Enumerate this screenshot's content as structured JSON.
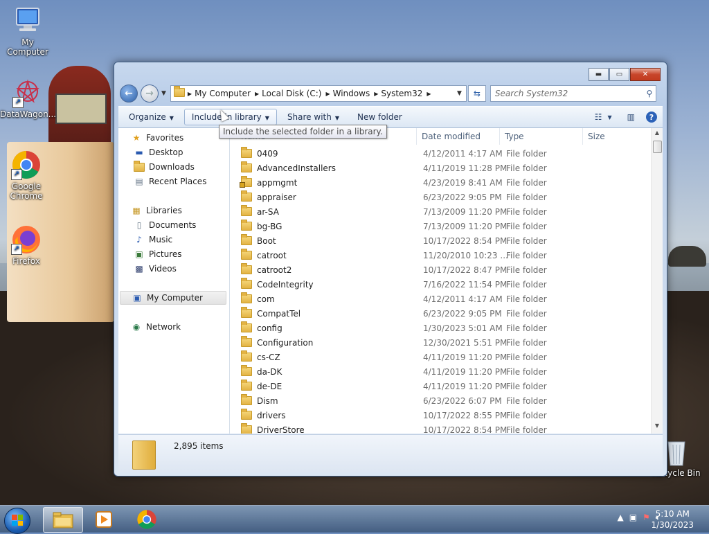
{
  "desktop": {
    "icons": [
      {
        "label": "My Computer"
      },
      {
        "label": "DataWagon..."
      },
      {
        "label": "Google Chrome"
      },
      {
        "label": "Firefox"
      },
      {
        "label": "Recycle Bin"
      }
    ]
  },
  "window": {
    "breadcrumb": [
      "My Computer",
      "Local Disk (C:)",
      "Windows",
      "System32"
    ],
    "search_placeholder": "Search System32",
    "toolbar": {
      "organize": "Organize",
      "include_in_library": "Include in library",
      "share_with": "Share with",
      "new_folder": "New folder"
    },
    "tooltip": "Include the selected folder in a library.",
    "nav": {
      "favorites": "Favorites",
      "desktop": "Desktop",
      "downloads": "Downloads",
      "recent_places": "Recent Places",
      "libraries": "Libraries",
      "documents": "Documents",
      "music": "Music",
      "pictures": "Pictures",
      "videos": "Videos",
      "my_computer": "My Computer",
      "network": "Network"
    },
    "columns": {
      "name": "Name",
      "date": "Date modified",
      "type": "Type",
      "size": "Size"
    },
    "files": [
      {
        "name": "0409",
        "date": "4/12/2011 4:17 AM",
        "type": "File folder"
      },
      {
        "name": "AdvancedInstallers",
        "date": "4/11/2019 11:28 PM",
        "type": "File folder"
      },
      {
        "name": "appmgmt",
        "date": "4/23/2019 8:41 AM",
        "type": "File folder"
      },
      {
        "name": "appraiser",
        "date": "6/23/2022 9:05 PM",
        "type": "File folder"
      },
      {
        "name": "ar-SA",
        "date": "7/13/2009 11:20 PM",
        "type": "File folder"
      },
      {
        "name": "bg-BG",
        "date": "7/13/2009 11:20 PM",
        "type": "File folder"
      },
      {
        "name": "Boot",
        "date": "10/17/2022 8:54 PM",
        "type": "File folder"
      },
      {
        "name": "catroot",
        "date": "11/20/2010 10:23 ...",
        "type": "File folder"
      },
      {
        "name": "catroot2",
        "date": "10/17/2022 8:47 PM",
        "type": "File folder"
      },
      {
        "name": "CodeIntegrity",
        "date": "7/16/2022 11:54 PM",
        "type": "File folder"
      },
      {
        "name": "com",
        "date": "4/12/2011 4:17 AM",
        "type": "File folder"
      },
      {
        "name": "CompatTel",
        "date": "6/23/2022 9:05 PM",
        "type": "File folder"
      },
      {
        "name": "config",
        "date": "1/30/2023 5:01 AM",
        "type": "File folder"
      },
      {
        "name": "Configuration",
        "date": "12/30/2021 5:51 PM",
        "type": "File folder"
      },
      {
        "name": "cs-CZ",
        "date": "4/11/2019 11:20 PM",
        "type": "File folder"
      },
      {
        "name": "da-DK",
        "date": "4/11/2019 11:20 PM",
        "type": "File folder"
      },
      {
        "name": "de-DE",
        "date": "4/11/2019 11:20 PM",
        "type": "File folder"
      },
      {
        "name": "Dism",
        "date": "6/23/2022 6:07 PM",
        "type": "File folder"
      },
      {
        "name": "drivers",
        "date": "10/17/2022 8:55 PM",
        "type": "File folder"
      },
      {
        "name": "DriverStore",
        "date": "10/17/2022 8:54 PM",
        "type": "File folder"
      }
    ],
    "item_count": "2,895 items"
  },
  "taskbar": {
    "time": "5:10 AM",
    "date": "1/30/2023"
  }
}
